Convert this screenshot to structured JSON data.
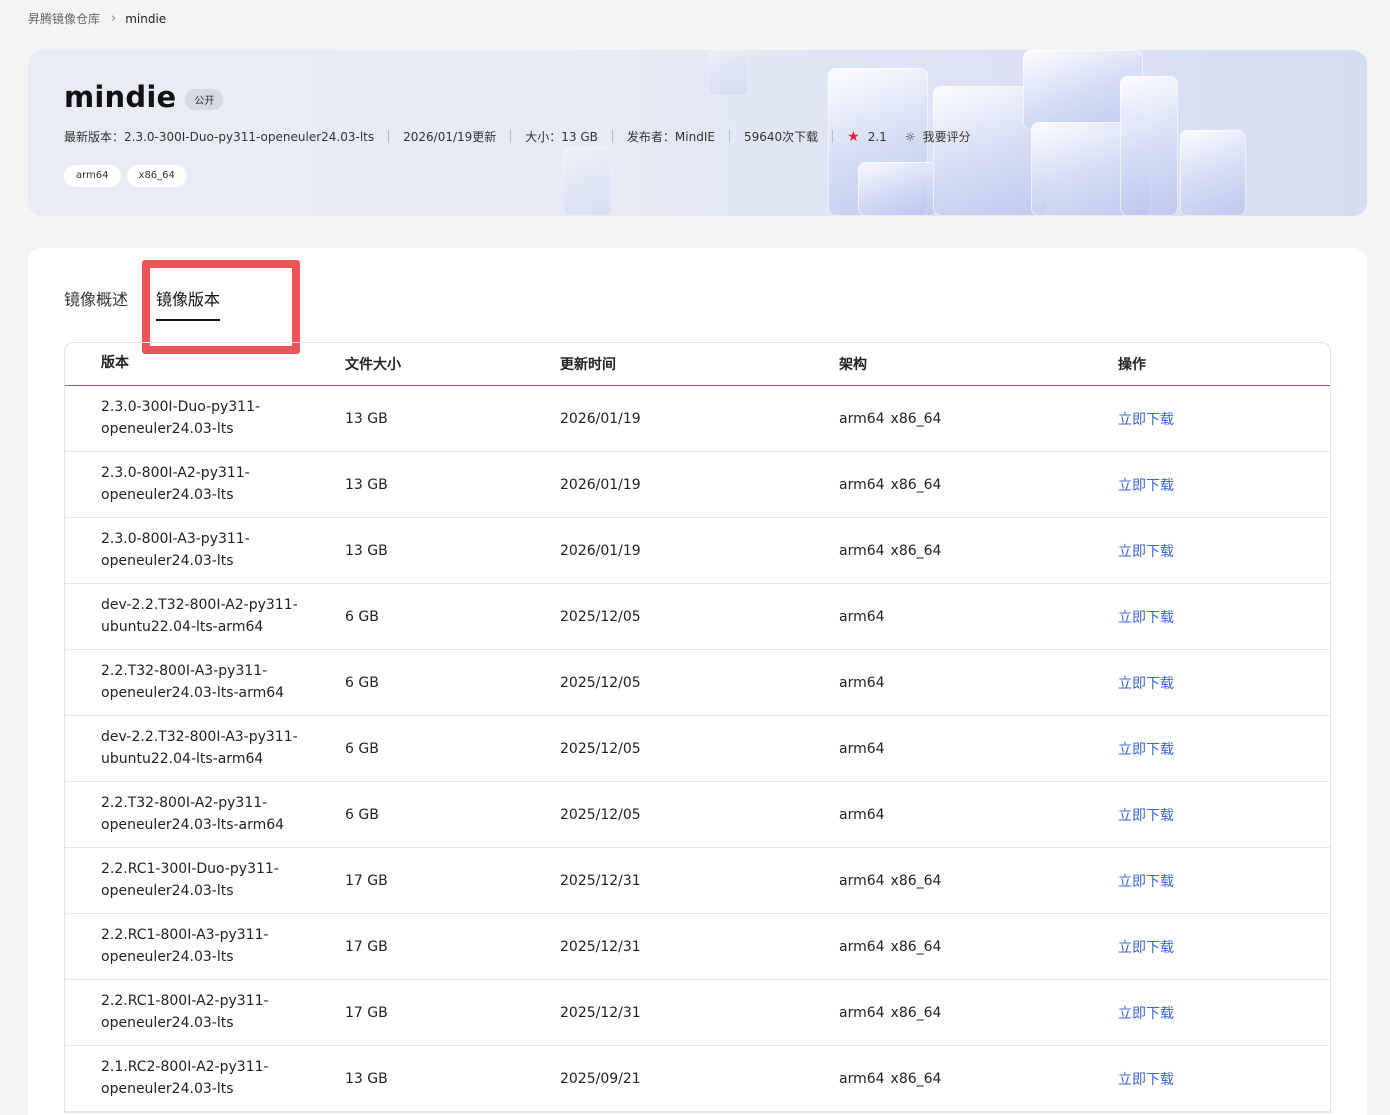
{
  "breadcrumb": {
    "root": "昇腾镜像仓库",
    "current": "mindie"
  },
  "banner": {
    "title": "mindie",
    "badge": "公开",
    "latest_version": "最新版本：2.3.0-300I-Duo-py311-openeuler24.03-lts",
    "updated": "2026/01/19更新",
    "size": "大小：13 GB",
    "publisher": "发布者：MindIE",
    "downloads": "59640次下载",
    "rating": "2.1",
    "rate_label": "我要评分",
    "tags": [
      "arm64",
      "x86_64"
    ]
  },
  "tabs": {
    "overview": "镜像概述",
    "versions": "镜像版本"
  },
  "table": {
    "headers": [
      "版本",
      "文件大小",
      "更新时间",
      "架构",
      "操作"
    ],
    "rows": [
      {
        "version": "2.3.0-300I-Duo-py311-openeuler24.03-lts",
        "size": "13 GB",
        "date": "2026/01/19",
        "arch": [
          "arm64",
          "x86_64"
        ],
        "action": "立即下载"
      },
      {
        "version": "2.3.0-800I-A2-py311-openeuler24.03-lts",
        "size": "13 GB",
        "date": "2026/01/19",
        "arch": [
          "arm64",
          "x86_64"
        ],
        "action": "立即下载"
      },
      {
        "version": "2.3.0-800I-A3-py311-openeuler24.03-lts",
        "size": "13 GB",
        "date": "2026/01/19",
        "arch": [
          "arm64",
          "x86_64"
        ],
        "action": "立即下载"
      },
      {
        "version": "dev-2.2.T32-800I-A2-py311-ubuntu22.04-lts-arm64",
        "size": "6 GB",
        "date": "2025/12/05",
        "arch": [
          "arm64"
        ],
        "action": "立即下载"
      },
      {
        "version": "2.2.T32-800I-A3-py311-openeuler24.03-lts-arm64",
        "size": "6 GB",
        "date": "2025/12/05",
        "arch": [
          "arm64"
        ],
        "action": "立即下载"
      },
      {
        "version": "dev-2.2.T32-800I-A3-py311-ubuntu22.04-lts-arm64",
        "size": "6 GB",
        "date": "2025/12/05",
        "arch": [
          "arm64"
        ],
        "action": "立即下载"
      },
      {
        "version": "2.2.T32-800I-A2-py311-openeuler24.03-lts-arm64",
        "size": "6 GB",
        "date": "2025/12/05",
        "arch": [
          "arm64"
        ],
        "action": "立即下载"
      },
      {
        "version": "2.2.RC1-300I-Duo-py311-openeuler24.03-lts",
        "size": "17 GB",
        "date": "2025/12/31",
        "arch": [
          "arm64",
          "x86_64"
        ],
        "action": "立即下载"
      },
      {
        "version": "2.2.RC1-800I-A3-py311-openeuler24.03-lts",
        "size": "17 GB",
        "date": "2025/12/31",
        "arch": [
          "arm64",
          "x86_64"
        ],
        "action": "立即下载"
      },
      {
        "version": "2.2.RC1-800I-A2-py311-openeuler24.03-lts",
        "size": "17 GB",
        "date": "2025/12/31",
        "arch": [
          "arm64",
          "x86_64"
        ],
        "action": "立即下载"
      },
      {
        "version": "2.1.RC2-800I-A2-py311-openeuler24.03-lts",
        "size": "13 GB",
        "date": "2025/09/21",
        "arch": [
          "arm64",
          "x86_64"
        ],
        "action": "立即下载"
      }
    ]
  },
  "colors": {
    "link": "#3d65d8",
    "highlight": "#f0525a",
    "star": "#e0212f"
  }
}
